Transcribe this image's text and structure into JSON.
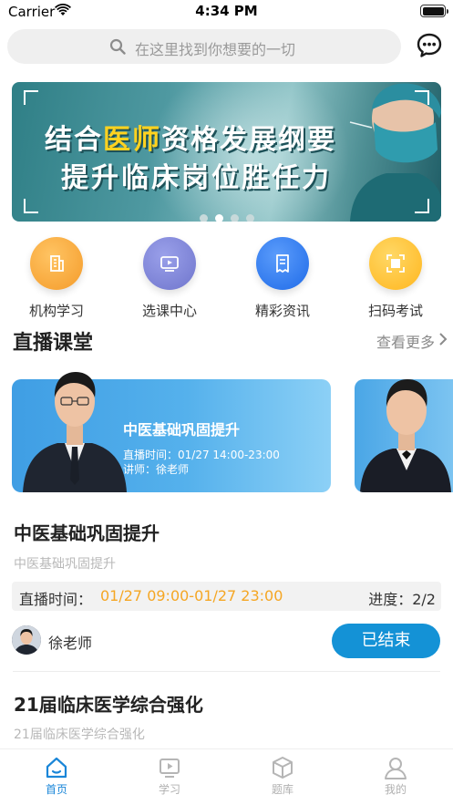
{
  "status_bar": {
    "carrier": "Carrier",
    "time": "4:34 PM"
  },
  "search": {
    "placeholder": "在这里找到你想要的一切"
  },
  "banner": {
    "line1_pre": "结合",
    "line1_highlight": "医师",
    "line1_post": "资格发展纲要",
    "line2": "提升临床岗位胜任力",
    "page_count": 4,
    "active_page": 2
  },
  "quick_links": [
    {
      "label": "机构学习",
      "icon": "building-icon",
      "color": "#f7a63b"
    },
    {
      "label": "选课中心",
      "icon": "video-play-icon",
      "color": "#7d83d6"
    },
    {
      "label": "精彩资讯",
      "icon": "news-icon",
      "color": "#2f7df0"
    },
    {
      "label": "扫码考试",
      "icon": "scan-icon",
      "color": "#ffc02a"
    }
  ],
  "live_section": {
    "title": "直播课堂",
    "more": "查看更多"
  },
  "live_cards": [
    {
      "title": "中医基础巩固提升",
      "time": "直播时间：01/27 14:00-23:00",
      "teacher": "讲师：徐老师"
    }
  ],
  "courses": [
    {
      "title": "中医基础巩固提升",
      "subtitle": "中医基础巩固提升",
      "time_label": "直播时间：",
      "time_value": "01/27 09:00-01/27 23:00",
      "progress": "进度：2/2",
      "teacher": "徐老师",
      "status": "已结束"
    },
    {
      "title": "21届临床医学综合强化",
      "subtitle": "21届临床医学综合强化"
    }
  ],
  "tabbar": [
    {
      "label": "首页",
      "active": true
    },
    {
      "label": "学习",
      "active": false
    },
    {
      "label": "题库",
      "active": false
    },
    {
      "label": "我的",
      "active": false
    }
  ],
  "colors": {
    "accent": "#1492d6",
    "time_value": "#f5a623"
  }
}
